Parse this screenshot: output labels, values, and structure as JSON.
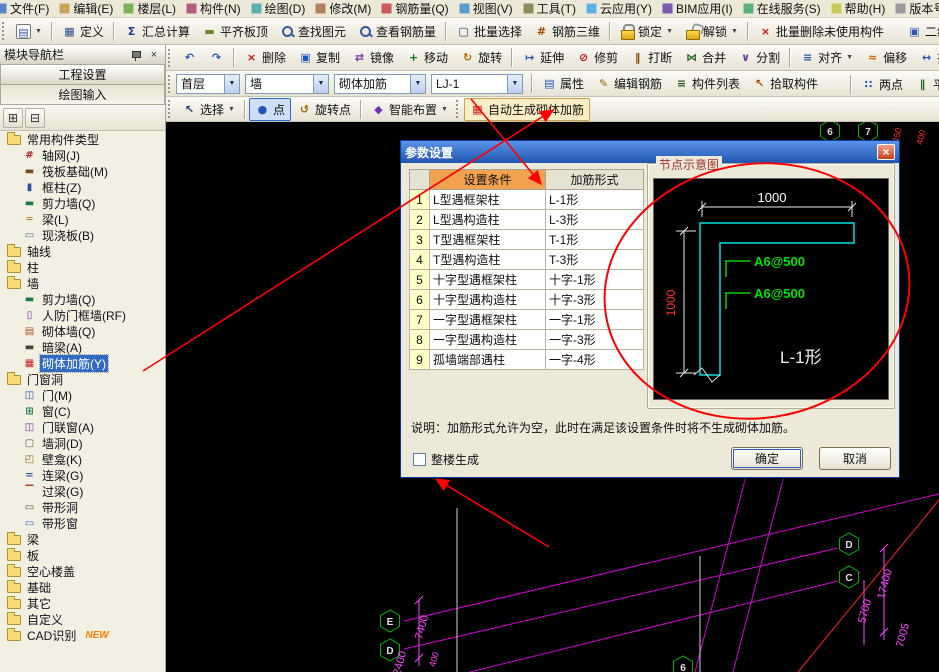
{
  "menu": {
    "items": [
      {
        "label": "文件(F)",
        "icon": "file-icon"
      },
      {
        "label": "编辑(E)",
        "icon": "edit-icon"
      },
      {
        "label": "楼层(L)",
        "icon": "floor-icon"
      },
      {
        "label": "构件(N)",
        "icon": "component-icon"
      },
      {
        "label": "绘图(D)",
        "icon": "draw-icon"
      },
      {
        "label": "修改(M)",
        "icon": "modify-icon"
      },
      {
        "label": "钢筋量(Q)",
        "icon": "rebar-quantity-icon"
      },
      {
        "label": "视图(V)",
        "icon": "view-icon"
      },
      {
        "label": "工具(T)",
        "icon": "tools-icon"
      },
      {
        "label": "云应用(Y)",
        "icon": "cloud-icon"
      },
      {
        "label": "BIM应用(I)",
        "icon": "bim-icon"
      },
      {
        "label": "在线服务(S)",
        "icon": "online-service-icon"
      },
      {
        "label": "帮助(H)",
        "icon": "help-icon"
      },
      {
        "label": "版本号(B)",
        "icon": "version-icon"
      }
    ]
  },
  "toolbar_file": {
    "items": [
      {
        "type": "grip"
      },
      {
        "icon": "doc-new-icon",
        "dropdown": true,
        "name": "new-button"
      },
      {
        "type": "sep"
      },
      {
        "icon": "define-icon",
        "label": "定义"
      },
      {
        "type": "sep"
      },
      {
        "icon": "sum-icon",
        "label": "汇总计算"
      },
      {
        "icon": "align-slab-icon",
        "label": "平齐板顶"
      },
      {
        "icon": "search-icon",
        "label": "查找图元"
      },
      {
        "icon": "view-rebar-icon",
        "label": "查看钢筋量"
      },
      {
        "type": "sep"
      },
      {
        "icon": "batch-select-icon",
        "label": "批量选择"
      },
      {
        "icon": "rebar-3d-icon",
        "label": "钢筋三维"
      },
      {
        "type": "sep"
      },
      {
        "icon": "lock-icon",
        "label": "锁定",
        "dropdown": true
      },
      {
        "icon": "unlock-icon",
        "label": "解锁",
        "dropdown": true
      },
      {
        "type": "sep"
      },
      {
        "icon": "batch-delete-icon",
        "label": "批量删除未使用构件"
      },
      {
        "icon": "second-view-icon",
        "label": "二维",
        "push": true
      }
    ]
  },
  "toolbar_edit": {
    "items": [
      {
        "type": "grip"
      },
      {
        "icon": "undo-icon",
        "name": "undo-button"
      },
      {
        "icon": "redo-icon",
        "name": "redo-button"
      },
      {
        "type": "sep"
      },
      {
        "icon": "delete-icon",
        "label": "删除"
      },
      {
        "icon": "copy-icon",
        "label": "复制"
      },
      {
        "icon": "mirror-icon",
        "label": "镜像"
      },
      {
        "icon": "move-icon",
        "label": "移动"
      },
      {
        "icon": "rotate-icon",
        "label": "旋转"
      },
      {
        "type": "sep"
      },
      {
        "icon": "extend-icon",
        "label": "延伸"
      },
      {
        "icon": "trim-icon",
        "label": "修剪"
      },
      {
        "icon": "break-icon",
        "label": "打断"
      },
      {
        "icon": "merge-icon",
        "label": "合并"
      },
      {
        "icon": "split-icon",
        "label": "分割"
      },
      {
        "type": "sep"
      },
      {
        "icon": "align-icon",
        "label": "对齐",
        "dropdown": true
      },
      {
        "icon": "offset-icon",
        "label": "偏移"
      },
      {
        "icon": "stretch-icon",
        "label": "拉伸"
      }
    ]
  },
  "toolbar_context": {
    "combos": [
      {
        "value": "首层",
        "name": "combo-floor"
      },
      {
        "value": "墙",
        "name": "combo-category"
      },
      {
        "value": "砌体加筋",
        "name": "combo-subcategory"
      },
      {
        "value": "LJ-1",
        "name": "combo-component"
      }
    ],
    "buttons": [
      {
        "icon": "props-icon",
        "label": "属性"
      },
      {
        "icon": "edit-rebar-icon",
        "label": "编辑钢筋"
      },
      {
        "icon": "list-icon",
        "label": "构件列表"
      },
      {
        "icon": "pick-icon",
        "label": "拾取构件"
      }
    ],
    "right_buttons": [
      {
        "icon": "two-point-icon",
        "label": "两点"
      },
      {
        "icon": "parallel-icon",
        "label": "平行"
      }
    ]
  },
  "toolbar_draw": {
    "items": [
      {
        "type": "grip"
      },
      {
        "icon": "select-icon",
        "label": "选择",
        "dropdown": true
      },
      {
        "type": "sep"
      },
      {
        "icon": "point-icon",
        "label": "点",
        "active": true
      },
      {
        "icon": "rotate-point-icon",
        "label": "旋转点"
      },
      {
        "type": "sep"
      },
      {
        "icon": "smart-icon",
        "label": "智能布置",
        "dropdown": true
      },
      {
        "type": "grip"
      },
      {
        "icon": "auto-gen-icon",
        "label": "自动生成砌体加筋",
        "hot": true,
        "name": "auto-generate-masonry-rebar-button"
      }
    ]
  },
  "sidebar": {
    "title": "模块导航栏",
    "sections": [
      "工程设置",
      "绘图输入"
    ],
    "tree": [
      {
        "label": "常用构件类型",
        "level": 0,
        "icon": "folder-icon"
      },
      {
        "label": "轴网(J)",
        "level": 1,
        "icon": "axis-grid-icon"
      },
      {
        "label": "筏板基础(M)",
        "level": 1,
        "icon": "raft-foundation-icon"
      },
      {
        "label": "框柱(Z)",
        "level": 1,
        "icon": "frame-column-icon"
      },
      {
        "label": "剪力墙(Q)",
        "level": 1,
        "icon": "shear-wall-icon"
      },
      {
        "label": "梁(L)",
        "level": 1,
        "icon": "beam-icon"
      },
      {
        "label": "现浇板(B)",
        "level": 1,
        "icon": "slab-icon"
      },
      {
        "label": "轴线",
        "level": 0,
        "icon": "folder-icon"
      },
      {
        "label": "柱",
        "level": 0,
        "icon": "folder-icon"
      },
      {
        "label": "墙",
        "level": 0,
        "icon": "folder-icon"
      },
      {
        "label": "剪力墙(Q)",
        "level": 1,
        "icon": "shear-wall-icon"
      },
      {
        "label": "人防门框墙(RF)",
        "level": 1,
        "icon": "air-defense-door-wall-icon"
      },
      {
        "label": "砌体墙(Q)",
        "level": 1,
        "icon": "masonry-wall-icon"
      },
      {
        "label": "暗梁(A)",
        "level": 1,
        "icon": "dark-beam-icon"
      },
      {
        "label": "砌体加筋(Y)",
        "level": 1,
        "icon": "masonry-rebar-icon",
        "selected": true
      },
      {
        "label": "门窗洞",
        "level": 0,
        "icon": "folder-icon"
      },
      {
        "label": "门(M)",
        "level": 1,
        "icon": "door-icon"
      },
      {
        "label": "窗(C)",
        "level": 1,
        "icon": "window-icon"
      },
      {
        "label": "门联窗(A)",
        "level": 1,
        "icon": "door-window-icon"
      },
      {
        "label": "墙洞(D)",
        "level": 1,
        "icon": "wall-hole-icon"
      },
      {
        "label": "壁龛(K)",
        "level": 1,
        "icon": "niche-icon"
      },
      {
        "label": "连梁(G)",
        "level": 1,
        "icon": "link-beam-icon"
      },
      {
        "label": "过梁(G)",
        "level": 1,
        "icon": "lintel-icon"
      },
      {
        "label": "带形洞",
        "level": 1,
        "icon": "strip-hole-icon"
      },
      {
        "label": "带形窗",
        "level": 1,
        "icon": "strip-window-icon"
      },
      {
        "label": "梁",
        "level": 0,
        "icon": "folder-icon"
      },
      {
        "label": "板",
        "level": 0,
        "icon": "folder-icon"
      },
      {
        "label": "空心楼盖",
        "level": 0,
        "icon": "folder-icon"
      },
      {
        "label": "基础",
        "level": 0,
        "icon": "folder-icon"
      },
      {
        "label": "其它",
        "level": 0,
        "icon": "folder-icon"
      },
      {
        "label": "自定义",
        "level": 0,
        "icon": "folder-icon"
      },
      {
        "label": "CAD识别",
        "level": 0,
        "icon": "folder-icon",
        "badge": "NEW"
      }
    ]
  },
  "dialog": {
    "title": "参数设置",
    "table": {
      "headers": [
        "设置条件",
        "加筋形式"
      ],
      "rows": [
        {
          "no": "1",
          "condition": "L型遇框架柱",
          "form": "L-1形"
        },
        {
          "no": "2",
          "condition": "L型遇构造柱",
          "form": "L-3形"
        },
        {
          "no": "3",
          "condition": "T型遇框架柱",
          "form": "T-1形"
        },
        {
          "no": "4",
          "condition": "T型遇构造柱",
          "form": "T-3形"
        },
        {
          "no": "5",
          "condition": "十字型遇框架柱",
          "form": "十字-1形"
        },
        {
          "no": "6",
          "condition": "十字型遇构造柱",
          "form": "十字-3形"
        },
        {
          "no": "7",
          "condition": "一字型遇框架柱",
          "form": "一字-1形"
        },
        {
          "no": "8",
          "condition": "一字型遇构造柱",
          "form": "一字-3形"
        },
        {
          "no": "9",
          "condition": "孤墙端部遇柱",
          "form": "一字-4形"
        }
      ]
    },
    "diagram": {
      "group_title": "节点示意图",
      "dim_top": "1000",
      "dim_left": "1000",
      "rebar1": "A6@500",
      "rebar2": "A6@500",
      "shape_label": "L-1形"
    },
    "note": "说明：加筋形式允许为空，此时在满足该设置条件时将不生成砌体加筋。",
    "checkbox_label": "整楼生成",
    "ok_label": "确定",
    "cancel_label": "取消"
  },
  "canvas_labels": {
    "bubble_e_left": "E",
    "bubble_d_left": "D",
    "bubble_d_right": "D",
    "bubble_c_right": "C",
    "bubble_6_top": "6",
    "bubble_7_top": "7",
    "bubble_6_bottom": "6",
    "dim_7400": "7400",
    "dim_2400": "2400",
    "dim_400_left": "400",
    "dim_17400": "17400",
    "dim_5700": "5700",
    "dim_7005": "7005",
    "dim_450_top": "450",
    "dim_400_top": "400"
  },
  "colors": {
    "accent_blue": "#316ac5",
    "header_orange": "#f2a24e",
    "annotation_red": "#ff0000",
    "cad_magenta": "#d400d4",
    "cad_green": "#00b400",
    "cad_cyan": "#00e0e0",
    "rebar_green": "#00d000"
  }
}
